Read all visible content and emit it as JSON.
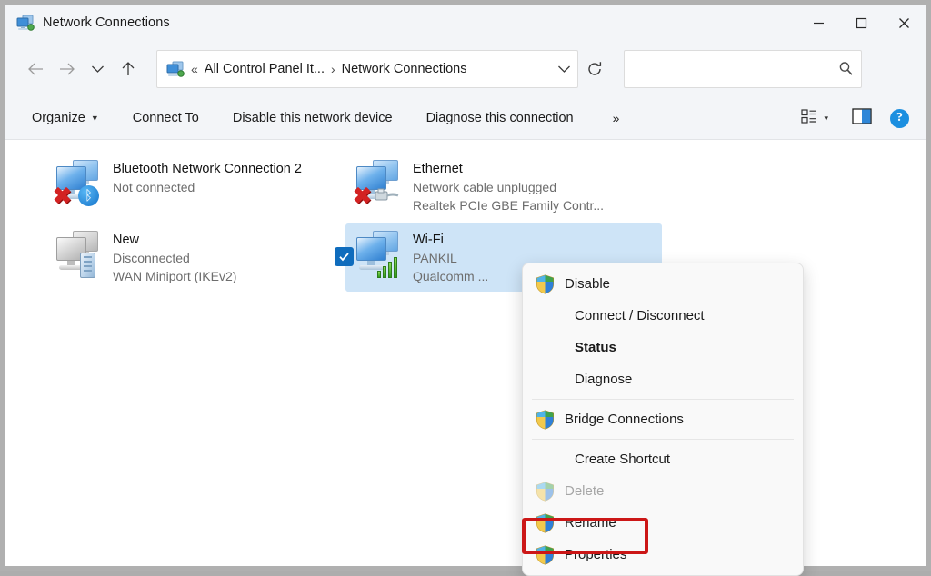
{
  "window": {
    "title": "Network Connections",
    "icon": "network-connections-icon",
    "controls": {
      "minimize": "−",
      "maximize": "□",
      "close": "✕"
    }
  },
  "nav": {
    "back_icon": "arrow-left-icon",
    "forward_icon": "arrow-right-icon",
    "recent_icon": "chevron-down-icon",
    "up_icon": "arrow-up-icon",
    "address": {
      "icon": "network-connections-icon",
      "prefix": "«",
      "crumbs": [
        "All Control Panel It...",
        "Network Connections"
      ],
      "separator": "›",
      "dropdown_icon": "chevron-down-icon",
      "refresh_icon": "refresh-icon"
    },
    "search": {
      "value": "",
      "placeholder": "",
      "icon": "search-icon"
    }
  },
  "toolbar": {
    "items": [
      {
        "label": "Organize",
        "has_caret": true
      },
      {
        "label": "Connect To",
        "has_caret": false
      },
      {
        "label": "Disable this network device",
        "has_caret": false
      },
      {
        "label": "Diagnose this connection",
        "has_caret": false
      }
    ],
    "overflow": "»",
    "view_icon": "view-options-icon",
    "view_caret": "▾",
    "preview_pane_icon": "preview-pane-icon",
    "help_icon": "help-icon",
    "help_glyph": "?"
  },
  "connections": [
    {
      "name": "Bluetooth Network Connection 2",
      "status": "Not connected",
      "device": "",
      "icon": "network-adapter-icon",
      "overlay": "bluetooth-badge-icon",
      "disabled_badge": "red-x-icon",
      "selected": false,
      "grayed": false
    },
    {
      "name": "Ethernet",
      "status": "Network cable unplugged",
      "device": "Realtek PCIe GBE Family Contr...",
      "icon": "network-adapter-icon",
      "overlay": "ethernet-cable-badge-icon",
      "disabled_badge": "red-x-icon",
      "selected": false,
      "grayed": false
    },
    {
      "name": "New",
      "status": "Disconnected",
      "device": "WAN Miniport (IKEv2)",
      "icon": "network-adapter-icon",
      "overlay": "wan-miniport-badge-icon",
      "disabled_badge": "",
      "selected": false,
      "grayed": true
    },
    {
      "name": "Wi-Fi",
      "status": "PANKIL",
      "device": "Qualcomm ...",
      "icon": "network-adapter-icon",
      "overlay": "wifi-signal-badge-icon",
      "disabled_badge": "",
      "selected": true,
      "grayed": false,
      "checkbox_checked": true
    }
  ],
  "context_menu": {
    "items": [
      {
        "label": "Disable",
        "shield": true,
        "bold": false,
        "disabled": false
      },
      {
        "label": "Connect / Disconnect",
        "shield": false,
        "bold": false,
        "disabled": false
      },
      {
        "label": "Status",
        "shield": false,
        "bold": true,
        "disabled": false
      },
      {
        "label": "Diagnose",
        "shield": false,
        "bold": false,
        "disabled": false
      },
      {
        "separator": true
      },
      {
        "label": "Bridge Connections",
        "shield": true,
        "bold": false,
        "disabled": false
      },
      {
        "separator": true
      },
      {
        "label": "Create Shortcut",
        "shield": false,
        "bold": false,
        "disabled": false
      },
      {
        "label": "Delete",
        "shield": true,
        "bold": false,
        "disabled": true
      },
      {
        "label": "Rename",
        "shield": true,
        "bold": false,
        "disabled": false
      },
      {
        "label": "Properties",
        "shield": true,
        "bold": false,
        "disabled": false,
        "highlighted": true
      }
    ]
  },
  "annotation": {
    "highlight_color": "#cc1717",
    "target": "Properties"
  },
  "colors": {
    "chrome": "#f3f5f8",
    "selection": "#cee4f7",
    "accent": "#0f6cbd",
    "menu_bg": "#f9f9f9",
    "border": "#b0b0b0"
  }
}
